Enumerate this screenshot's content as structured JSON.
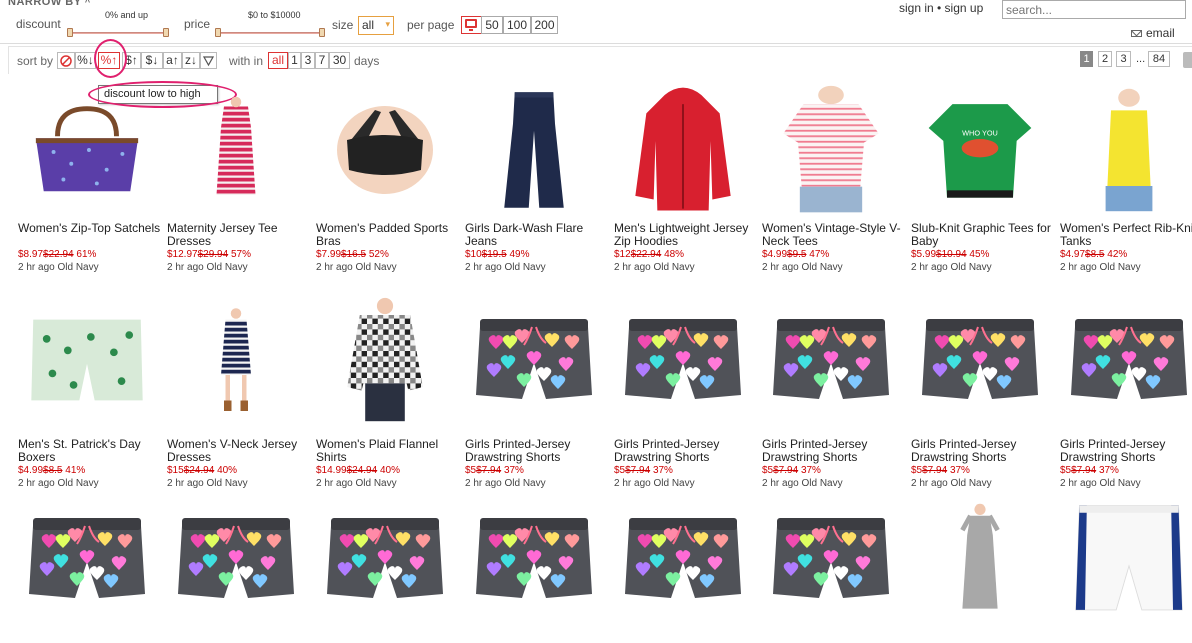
{
  "filters": {
    "narrow_by": "NARROW BY",
    "discount_label": "discount",
    "discount_range": "0% and up",
    "price_label": "price",
    "price_range": "$0 to $10000",
    "size_label": "size",
    "size_value": "all",
    "per_page_label": "per page",
    "per_page_options": [
      "50",
      "100",
      "200"
    ]
  },
  "account": {
    "auth_text": "sign in • sign up",
    "search_placeholder": "search...",
    "email_label": "email"
  },
  "sortbar": {
    "sort_label": "sort by",
    "sort_buttons": [
      "%↓",
      "%↑",
      "$↑",
      "$↓",
      "a↑",
      "z↓"
    ],
    "within_label": "with in",
    "days_options": [
      "all",
      "1",
      "3",
      "7",
      "30"
    ],
    "days_label": "days",
    "pages": [
      "1",
      "2",
      "3",
      "84"
    ],
    "ellipsis": "...",
    "tooltip": "discount low to high"
  },
  "products": [
    {
      "title": "Women's Zip-Top Satchels",
      "price": "$8.97",
      "was": "$22.94",
      "discount": "61%",
      "meta": "2 hr ago Old Navy",
      "icon": "purple-satchel"
    },
    {
      "title": "Maternity Jersey Tee Dresses",
      "price": "$12.97",
      "was": "$29.94",
      "discount": "57%",
      "meta": "2 hr ago Old Navy",
      "icon": "pink-striped-dress"
    },
    {
      "title": "Women's Padded Sports Bras",
      "price": "$7.99",
      "was": "$16.5",
      "discount": "52%",
      "meta": "2 hr ago Old Navy",
      "icon": "black-sports-bra"
    },
    {
      "title": "Girls Dark-Wash Flare Jeans",
      "price": "$10",
      "was": "$19.5",
      "discount": "49%",
      "meta": "2 hr ago Old Navy",
      "icon": "flare-jeans"
    },
    {
      "title": "Men's Lightweight Jersey Zip Hoodies",
      "price": "$12",
      "was": "$22.94",
      "discount": "48%",
      "meta": "2 hr ago Old Navy",
      "icon": "red-hoodie"
    },
    {
      "title": "Women's Vintage-Style V-Neck Tees",
      "price": "$4.99",
      "was": "$9.5",
      "discount": "47%",
      "meta": "2 hr ago Old Navy",
      "icon": "striped-vneck"
    },
    {
      "title": "Slub-Knit Graphic Tees for Baby",
      "price": "$5.99",
      "was": "$10.94",
      "discount": "45%",
      "meta": "2 hr ago Old Navy",
      "icon": "green-graphic-tee"
    },
    {
      "title": "Women's Perfect Rib-Knit Tanks",
      "price": "$4.97",
      "was": "$8.5",
      "discount": "42%",
      "meta": "2 hr ago Old Navy",
      "icon": "yellow-tank"
    },
    {
      "title": "Men's St. Patrick's Day Boxers",
      "price": "$4.99",
      "was": "$8.5",
      "discount": "41%",
      "meta": "2 hr ago Old Navy",
      "icon": "green-boxers"
    },
    {
      "title": "Women's V-Neck Jersey Dresses",
      "price": "$15",
      "was": "$24.94",
      "discount": "40%",
      "meta": "2 hr ago Old Navy",
      "icon": "navy-striped-dress"
    },
    {
      "title": "Women's Plaid Flannel Shirts",
      "price": "$14.99",
      "was": "$24.94",
      "discount": "40%",
      "meta": "2 hr ago Old Navy",
      "icon": "plaid-shirt"
    },
    {
      "title": "Girls Printed-Jersey Drawstring Shorts",
      "price": "$5",
      "was": "$7.94",
      "discount": "37%",
      "meta": "2 hr ago Old Navy",
      "icon": "heart-shorts"
    },
    {
      "title": "Girls Printed-Jersey Drawstring Shorts",
      "price": "$5",
      "was": "$7.94",
      "discount": "37%",
      "meta": "2 hr ago Old Navy",
      "icon": "heart-shorts"
    },
    {
      "title": "Girls Printed-Jersey Drawstring Shorts",
      "price": "$5",
      "was": "$7.94",
      "discount": "37%",
      "meta": "2 hr ago Old Navy",
      "icon": "heart-shorts"
    },
    {
      "title": "Girls Printed-Jersey Drawstring Shorts",
      "price": "$5",
      "was": "$7.94",
      "discount": "37%",
      "meta": "2 hr ago Old Navy",
      "icon": "heart-shorts"
    },
    {
      "title": "Girls Printed-Jersey Drawstring Shorts",
      "price": "$5",
      "was": "$7.94",
      "discount": "37%",
      "meta": "2 hr ago Old Navy",
      "icon": "heart-shorts"
    },
    {
      "title": "",
      "price": "",
      "was": "",
      "discount": "",
      "meta": "",
      "icon": "heart-shorts"
    },
    {
      "title": "",
      "price": "",
      "was": "",
      "discount": "",
      "meta": "",
      "icon": "heart-shorts"
    },
    {
      "title": "",
      "price": "",
      "was": "",
      "discount": "",
      "meta": "",
      "icon": "heart-shorts"
    },
    {
      "title": "",
      "price": "",
      "was": "",
      "discount": "",
      "meta": "",
      "icon": "heart-shorts"
    },
    {
      "title": "",
      "price": "",
      "was": "",
      "discount": "",
      "meta": "",
      "icon": "heart-shorts"
    },
    {
      "title": "",
      "price": "",
      "was": "",
      "discount": "",
      "meta": "",
      "icon": "heart-shorts"
    },
    {
      "title": "",
      "price": "",
      "was": "",
      "discount": "",
      "meta": "",
      "icon": "gray-maxi-dress"
    },
    {
      "title": "",
      "price": "",
      "was": "",
      "discount": "",
      "meta": "",
      "icon": "white-athletic-shorts"
    }
  ],
  "colors": {
    "accent": "#d33333",
    "annotation": "#e0206e",
    "price": "#cc0000"
  }
}
